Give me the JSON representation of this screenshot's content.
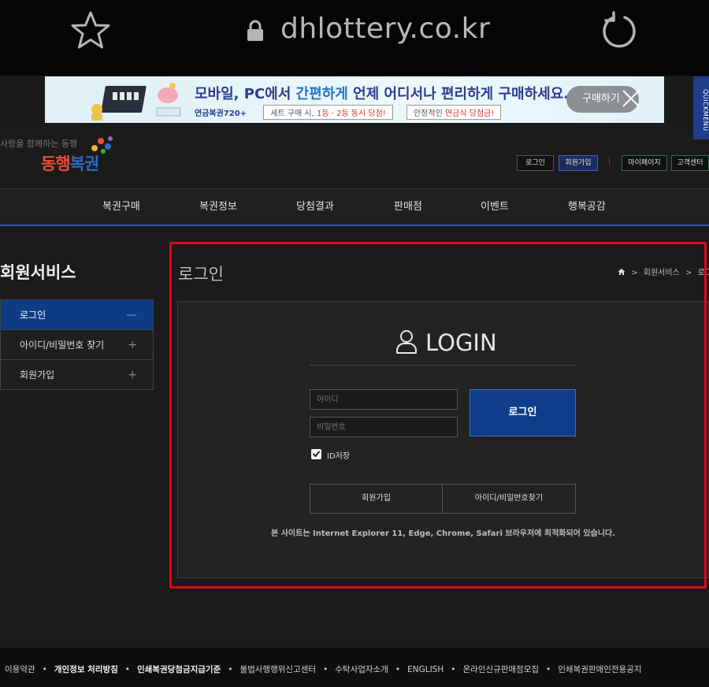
{
  "browser": {
    "url": "dhlottery.co.kr",
    "icons": [
      "star-icon",
      "lock-icon",
      "reload-icon"
    ]
  },
  "banner": {
    "headline_pre": "모바일, PC에서 ",
    "headline_highlight": "간편하게",
    "headline_post": " 언제 어디서나 편리하게 구매하세요.",
    "brand": "연금복권720+",
    "set_text_pre": "세트 구매 시, ",
    "set_text_highlight": "1등 · 2등 동시 당첨!",
    "stable_pre": "안정적인 ",
    "stable_highlight": "연금식 당첨금!",
    "buy_label": "구매하기",
    "quickmenu": "QUICKMENU"
  },
  "header": {
    "logo_tagline": "사랑을 함께하는 동행",
    "logo_name_1": "동행",
    "logo_name_2": "복권",
    "links": {
      "login": "로그인",
      "join": "회원가입",
      "sep": "|",
      "mypage": "마이페이지",
      "customer": "고객센터"
    },
    "nav": [
      "복권구매",
      "복권정보",
      "당첨결과",
      "판매점",
      "이벤트",
      "행복공감"
    ]
  },
  "sidebar": {
    "title": "회원서비스",
    "items": [
      {
        "label": "로그인",
        "sign": "—"
      },
      {
        "label": "아이디/비밀번호 찾기",
        "sign": "+"
      },
      {
        "label": "회원가입",
        "sign": "+"
      }
    ]
  },
  "content": {
    "title": "로그인",
    "breadcrumb": {
      "sep": ">",
      "item1": "회원서비스",
      "item2": "로그인"
    }
  },
  "login": {
    "heading": "LOGIN",
    "id_placeholder": "아이디",
    "pw_placeholder": "비밀번호",
    "button": "로그인",
    "save_id_label": "ID저장",
    "save_id_checked": true,
    "join_button": "회원가입",
    "find_button": "아이디/비밀번호찾기",
    "notice": "본 사이트는 Internet Explorer 11, Edge, Chrome, Safari 브라우저에 최적화되어 있습니다."
  },
  "footer": {
    "links": [
      {
        "label": "이용약관",
        "bold": false
      },
      {
        "label": "개인정보 처리방침",
        "bold": true
      },
      {
        "label": "인쇄복권당첨금지급기준",
        "bold": true
      },
      {
        "label": "불법사행행위신고센터",
        "bold": false
      },
      {
        "label": "수탁사업자소개",
        "bold": false
      },
      {
        "label": "ENGLISH",
        "bold": false
      },
      {
        "label": "온라인신규판매점모집",
        "bold": false
      },
      {
        "label": "인쇄복권판매인전용공지",
        "bold": false
      }
    ],
    "separator": "•"
  },
  "colors": {
    "accent_blue": "#0e3e8a",
    "highlight_frame": "#e30613",
    "background": "#1b1b1b"
  }
}
